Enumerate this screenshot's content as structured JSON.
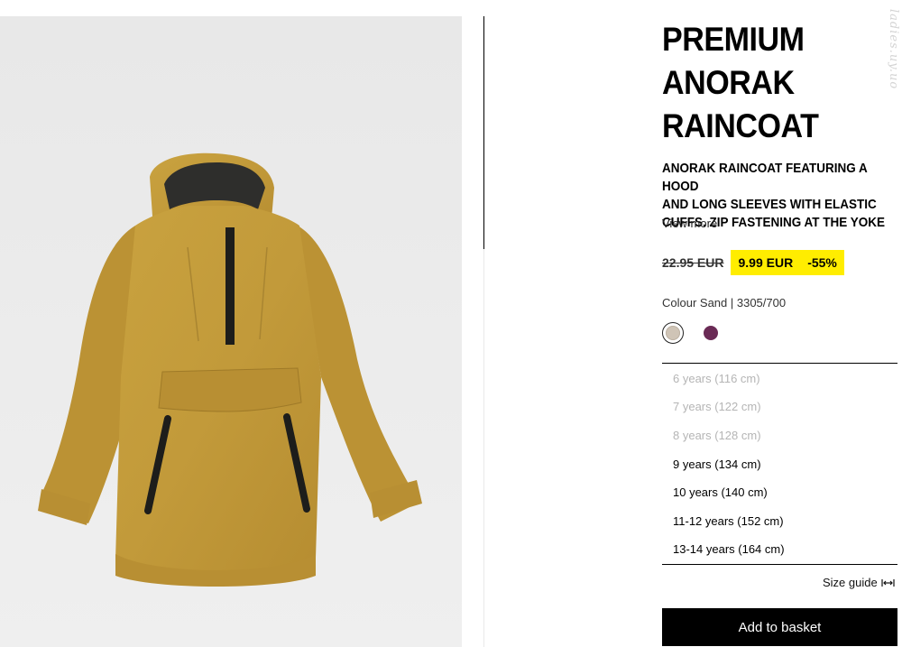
{
  "product": {
    "title_lines": [
      "PREMIUM",
      "ANORAK",
      "RAINCOAT"
    ],
    "description_lines": [
      "ANORAK RAINCOAT FEATURING A HOOD",
      "AND LONG SLEEVES WITH ELASTIC",
      "CUFFS. ZIP FASTENING AT THE YOKE"
    ],
    "view_more": "View more",
    "price": {
      "old": "22.95 EUR",
      "new": "9.99 EUR",
      "discount": "-55%"
    },
    "colour_line": "Colour Sand | 3305/700",
    "swatches": [
      {
        "name": "Sand",
        "color": "#cfc4b6",
        "selected": true
      },
      {
        "name": "Purple",
        "color": "#6a2a55",
        "selected": false
      }
    ],
    "sizes": [
      {
        "label": "6 years (116 cm)",
        "available": false
      },
      {
        "label": "7 years (122 cm)",
        "available": false
      },
      {
        "label": "8 years (128 cm)",
        "available": false
      },
      {
        "label": "9 years (134 cm)",
        "available": true
      },
      {
        "label": "10 years (140 cm)",
        "available": true
      },
      {
        "label": "11-12 years (152 cm)",
        "available": true
      },
      {
        "label": "13-14 years (164 cm)",
        "available": true
      }
    ],
    "size_guide": "Size guide",
    "add_to_basket": "Add to basket"
  },
  "watermark": "ladies.uy.uo",
  "colors": {
    "highlight": "#ffed00",
    "garment": "#c39a3c",
    "button": "#000000"
  }
}
